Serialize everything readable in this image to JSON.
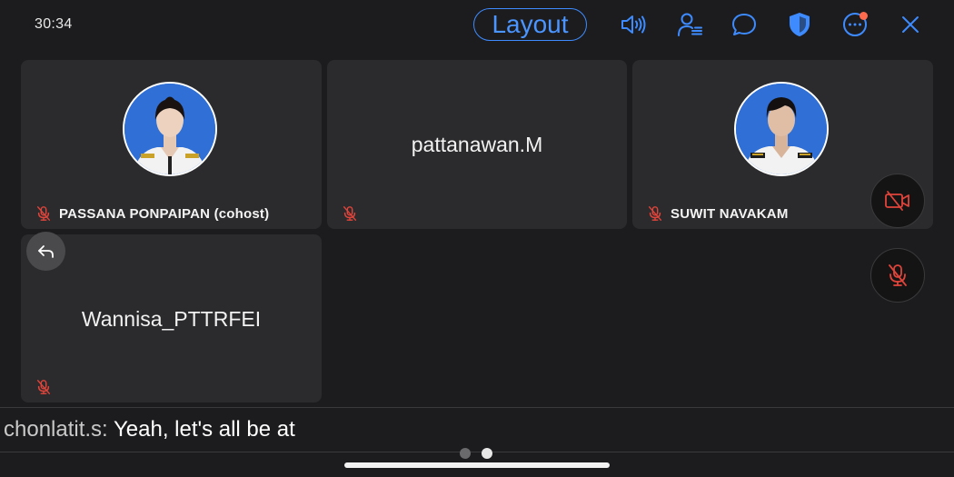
{
  "meeting": {
    "timer": "30:34",
    "layout_label": "Layout",
    "unread_indicator": true
  },
  "toolbar": {
    "icons": [
      "speaker-icon",
      "participants-icon",
      "chat-icon",
      "security-icon",
      "more-icon",
      "close-icon"
    ]
  },
  "participants": [
    {
      "name": "PASSANA PONPAIPAN (cohost)",
      "has_photo": true,
      "muted": true
    },
    {
      "name": "pattanawan.M",
      "has_photo": false,
      "muted": true
    },
    {
      "name": "SUWIT NAVAKAM",
      "has_photo": true,
      "muted": true
    },
    {
      "name": "Wannisa_PTTRFEI",
      "has_photo": false,
      "muted": true
    }
  ],
  "self_controls": {
    "video_off": true,
    "mic_off": true
  },
  "caption": {
    "speaker": "chonlatit.s:",
    "text": "Yeah, let's all be at"
  },
  "pagination": {
    "total": 2,
    "current": 2
  },
  "colors": {
    "accent": "#3d8bff",
    "muted_red": "#e0443a",
    "tile_bg": "#2b2b2d",
    "background": "#1c1c1e"
  }
}
